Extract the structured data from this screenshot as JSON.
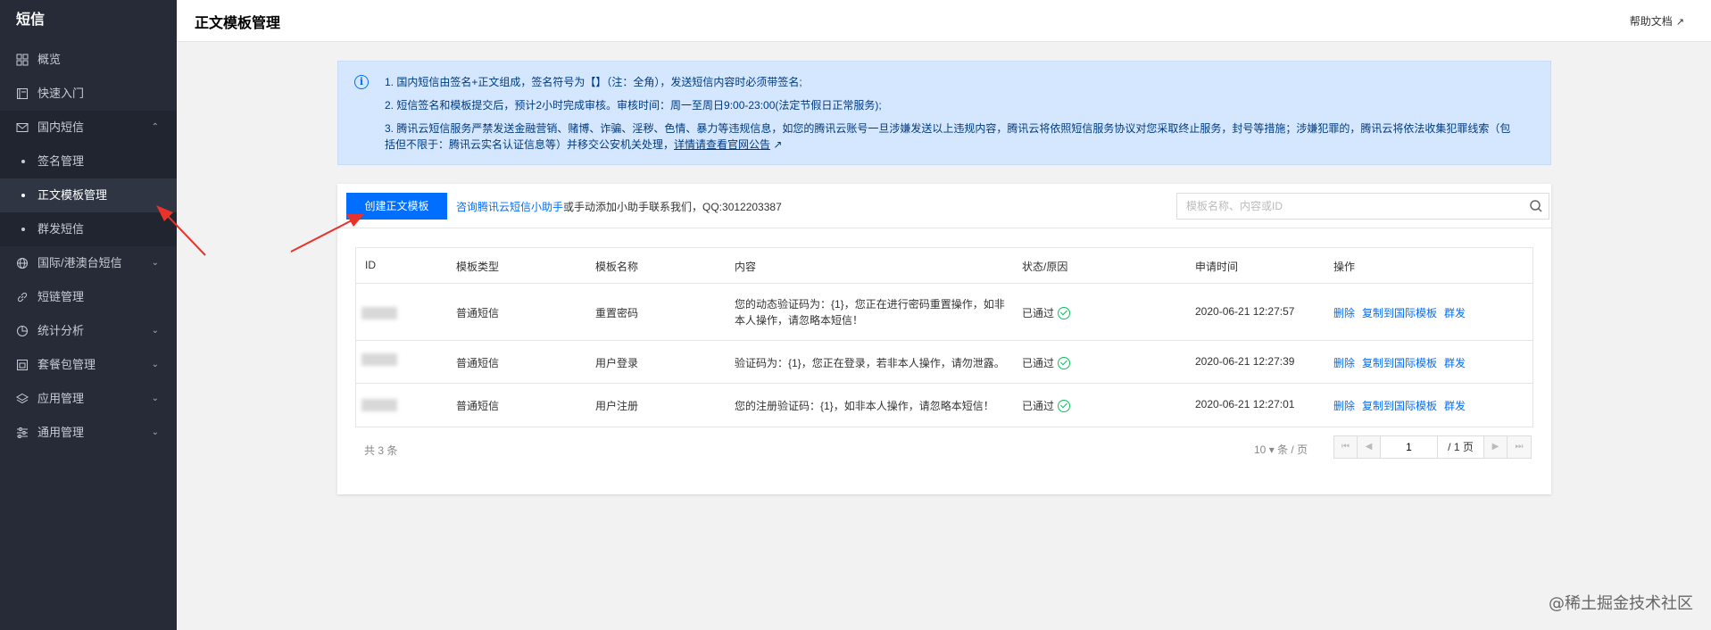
{
  "sidebar": {
    "title": "短信",
    "items": [
      {
        "label": "概览"
      },
      {
        "label": "快速入门"
      },
      {
        "label": "国内短信"
      },
      {
        "label": "国际/港澳台短信"
      },
      {
        "label": "短链管理"
      },
      {
        "label": "统计分析"
      },
      {
        "label": "套餐包管理"
      },
      {
        "label": "应用管理"
      },
      {
        "label": "通用管理"
      }
    ],
    "sub_items": [
      {
        "label": "签名管理"
      },
      {
        "label": "正文模板管理"
      },
      {
        "label": "群发短信"
      }
    ]
  },
  "header": {
    "title": "正文模板管理",
    "help": "帮助文档"
  },
  "notice": {
    "line1": "1. 国内短信由签名+正文组成，签名符号为【】（注：全角），发送短信内容时必须带签名;",
    "line2": "2. 短信签名和模板提交后，预计2小时完成审核。审核时间：周一至周日9:00-23:00(法定节假日正常服务);",
    "line3a": "3. 腾讯云短信服务严禁发送金融营销、赌博、诈骗、淫秽、色情、暴力等违规信息，如您的腾讯云账号一旦涉嫌发送以上违规内容，腾讯云将依照短信服务协议对您采取终止服务，封号等措施；涉嫌犯罪的，腾讯云将依法收集犯罪线索（包",
    "line3b": "括但不限于：腾讯云实名认证信息等）并移交公安机关处理，",
    "line3_link": "详情请查看官网公告"
  },
  "toolbar": {
    "create_label": "创建正文模板",
    "consult_link": "咨询腾讯云短信小助手",
    "consult_text": "或手动添加小助手联系我们，QQ:3012203387",
    "search_placeholder": "模板名称、内容或ID"
  },
  "table": {
    "headers": [
      "ID",
      "模板类型",
      "模板名称",
      "内容",
      "状态/原因",
      "申请时间",
      "操作"
    ],
    "rows": [
      {
        "type": "普通短信",
        "name": "重置密码",
        "content1": "您的动态验证码为：{1}，您正在进行密码重置操作，如非",
        "content2": "本人操作，请忽略本短信！",
        "status": "已通过",
        "time": "2020-06-21 12:27:57"
      },
      {
        "type": "普通短信",
        "name": "用户登录",
        "content1": "验证码为：{1}，您正在登录，若非本人操作，请勿泄露。",
        "content2": "",
        "status": "已通过",
        "time": "2020-06-21 12:27:39"
      },
      {
        "type": "普通短信",
        "name": "用户注册",
        "content1": "您的注册验证码：{1}，如非本人操作，请忽略本短信！",
        "content2": "",
        "status": "已通过",
        "time": "2020-06-21 12:27:01"
      }
    ],
    "ops": [
      "删除",
      "复制到国际模板",
      "群发"
    ]
  },
  "footer": {
    "total": "共 3 条",
    "page_size": "10",
    "page_size_unit": "条 / 页",
    "page": "1",
    "page_total": "/ 1 页"
  },
  "watermark": "@稀土掘金技术社区"
}
